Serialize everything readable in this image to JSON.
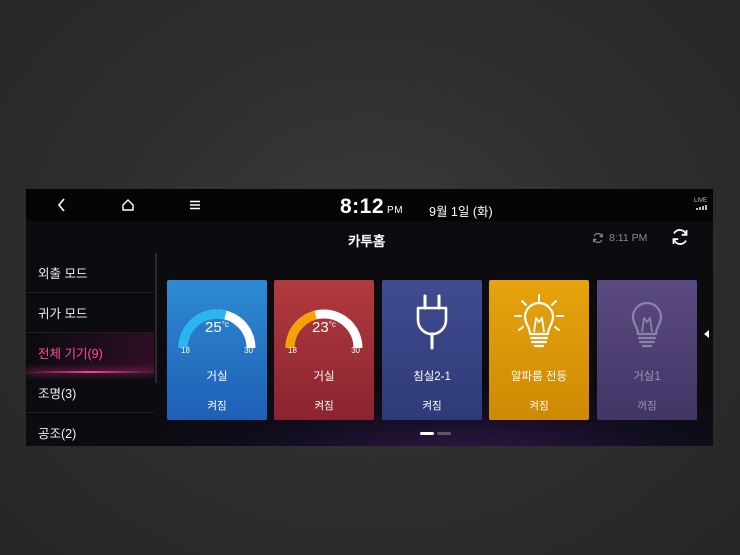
{
  "status_bar": {
    "back_icon": "chevron-left-icon",
    "home_icon": "home-icon",
    "menu_icon": "hamburger-menu-icon",
    "time": "8:12",
    "ampm": "PM",
    "date": "9월 1일 (화)",
    "signal_label": "LIVE"
  },
  "header": {
    "title": "카투홈",
    "last_sync": "8:11 PM",
    "sync_icon": "sync-icon",
    "refresh_icon": "refresh-icon"
  },
  "sidebar": {
    "items": [
      {
        "label": "외출 모드",
        "active": false
      },
      {
        "label": "귀가 모드",
        "active": false
      },
      {
        "label": "전체 기기(9)",
        "active": true
      },
      {
        "label": "조명(3)",
        "active": false
      },
      {
        "label": "공조(2)",
        "active": false
      }
    ]
  },
  "devices": [
    {
      "type": "thermostat",
      "name": "거실",
      "state": "켜짐",
      "temp": "25",
      "unit": "°c",
      "min": "18",
      "max": "30",
      "level": 0.58,
      "accent": "#29b6f0",
      "color": "#2d8ad2"
    },
    {
      "type": "thermostat",
      "name": "거실",
      "state": "켜짐",
      "temp": "23",
      "unit": "°c",
      "min": "18",
      "max": "30",
      "level": 0.42,
      "accent": "#f5a300",
      "color": "#b23a3e"
    },
    {
      "type": "plug",
      "name": "침실2-1",
      "state": "켜짐",
      "icon": "plug-icon",
      "color": "#3f4c8f"
    },
    {
      "type": "light",
      "name": "알파룸 전등",
      "state": "켜짐",
      "icon": "lightbulb-on-icon",
      "color": "#e6a30c"
    },
    {
      "type": "light",
      "name": "거실1",
      "state": "꺼짐",
      "icon": "lightbulb-off-icon",
      "color": "#5a4a80"
    }
  ],
  "pagination": {
    "pages": 2,
    "current": 1
  },
  "colors": {
    "accent_pink": "#ff3d9a",
    "background": "#0b0b10"
  }
}
